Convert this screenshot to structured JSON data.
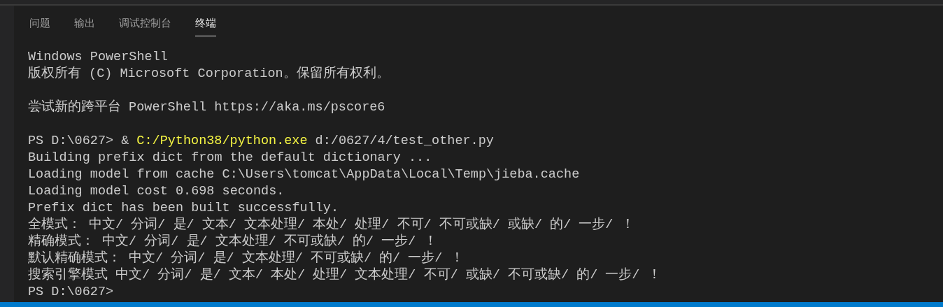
{
  "tabs": [
    {
      "label": "问题",
      "selected": false
    },
    {
      "label": "输出",
      "selected": false
    },
    {
      "label": "调试控制台",
      "selected": false
    },
    {
      "label": "终端",
      "selected": true
    }
  ],
  "terminal": {
    "lines": [
      {
        "kind": "output",
        "text": "Windows PowerShell"
      },
      {
        "kind": "output",
        "text": "版权所有 (C) Microsoft Corporation。保留所有权利。"
      },
      {
        "kind": "blank"
      },
      {
        "kind": "output",
        "text": "尝试新的跨平台 PowerShell https://aka.ms/pscore6"
      },
      {
        "kind": "blank"
      },
      {
        "kind": "command",
        "prompt": "PS D:\\0627> &",
        "command": "C:/Python38/python.exe",
        "args": "d:/0627/4/test_other.py"
      },
      {
        "kind": "output",
        "text": "Building prefix dict from the default dictionary ..."
      },
      {
        "kind": "output",
        "text": "Loading model from cache C:\\Users\\tomcat\\AppData\\Local\\Temp\\jieba.cache"
      },
      {
        "kind": "output",
        "text": "Loading model cost 0.698 seconds."
      },
      {
        "kind": "output",
        "text": "Prefix dict has been built successfully."
      },
      {
        "kind": "output",
        "text": "全模式： 中文/ 分词/ 是/ 文本/ 文本处理/ 本处/ 处理/ 不可/ 不可或缺/ 或缺/ 的/ 一步/ ！"
      },
      {
        "kind": "output",
        "text": "精确模式： 中文/ 分词/ 是/ 文本处理/ 不可或缺/ 的/ 一步/ ！"
      },
      {
        "kind": "output",
        "text": "默认精确模式： 中文/ 分词/ 是/ 文本处理/ 不可或缺/ 的/ 一步/ ！"
      },
      {
        "kind": "output",
        "text": "搜索引擎模式 中文/ 分词/ 是/ 文本/ 本处/ 处理/ 文本处理/ 不可/ 或缺/ 不可或缺/ 的/ 一步/ ！"
      },
      {
        "kind": "output",
        "text": "PS D:\\0627>"
      }
    ]
  }
}
